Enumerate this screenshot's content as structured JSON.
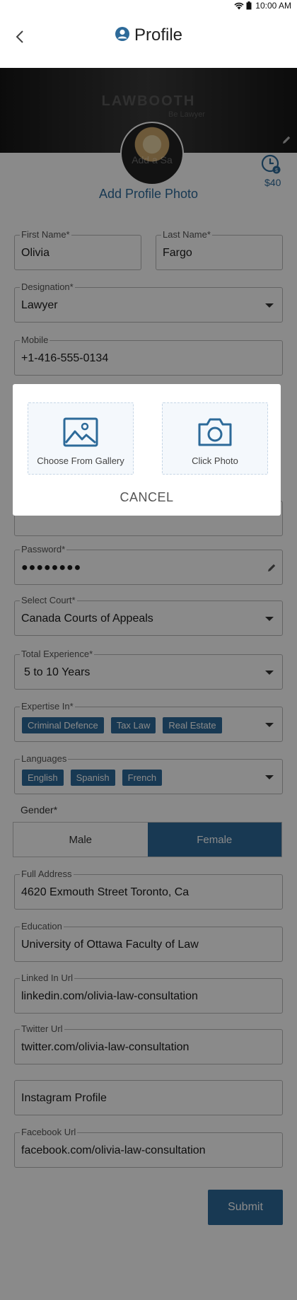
{
  "status_bar": {
    "time": "10:00 AM"
  },
  "header": {
    "title": "Profile"
  },
  "banner": {
    "brand": "LAWBOOTH",
    "brand_sub": "Be Lawyer"
  },
  "profile_photo": {
    "overlay_text": "Add a Sa",
    "add_label": "Add Profile Photo"
  },
  "consult": {
    "price": "$40"
  },
  "fields": {
    "first_name": {
      "label": "First Name*",
      "value": "Olivia"
    },
    "last_name": {
      "label": "Last Name*",
      "value": "Fargo"
    },
    "designation": {
      "label": "Designation*",
      "value": "Lawyer"
    },
    "mobile": {
      "label": "Mobile",
      "value": "+1-416-555-0134"
    },
    "password": {
      "label": "Password*",
      "value": "●●●●●●●●"
    },
    "court": {
      "label": "Select Court*",
      "value": "Canada Courts of Appeals"
    },
    "experience": {
      "label": "Total Experience*",
      "value": "5 to 10 Years"
    },
    "expertise": {
      "label": "Expertise In*",
      "chips": [
        "Criminal Defence",
        "Tax Law",
        "Real Estate"
      ]
    },
    "languages": {
      "label": "Languages",
      "chips": [
        "English",
        "Spanish",
        "French"
      ]
    },
    "address": {
      "label": "Full Address",
      "value": "4620  Exmouth Street Toronto, Ca"
    },
    "education": {
      "label": "Education",
      "value": "University of Ottawa Faculty of Law"
    },
    "linkedin": {
      "label": "Linked In Url",
      "value": "linkedin.com/olivia-law-consultation"
    },
    "twitter": {
      "label": "Twitter Url",
      "value": "twitter.com/olivia-law-consultation"
    },
    "instagram": {
      "placeholder": "Instagram Profile"
    },
    "facebook": {
      "label": "Facebook Url",
      "value": "facebook.com/olivia-law-consultation"
    }
  },
  "gender": {
    "label": "Gender*",
    "options": [
      "Male",
      "Female"
    ],
    "selected": "Female"
  },
  "submit_label": "Submit",
  "dialog": {
    "gallery_label": "Choose From Gallery",
    "camera_label": "Click Photo",
    "cancel_label": "CANCEL"
  },
  "colors": {
    "accent": "#2d6a99",
    "overlay": "rgba(0,0,0,0.46)"
  }
}
